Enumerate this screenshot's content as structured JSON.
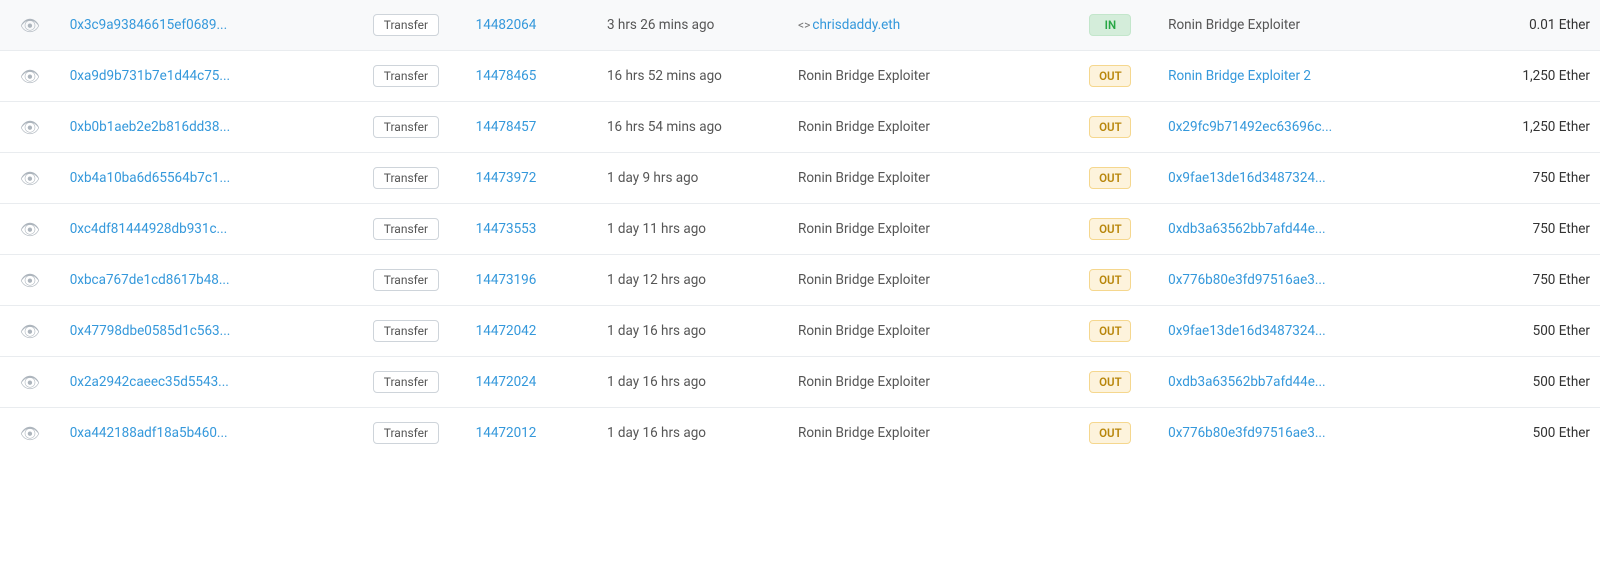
{
  "table": {
    "rows": [
      {
        "txHash": "0x3c9a93846615ef0689...",
        "type": "Transfer",
        "block": "14482064",
        "age": "3 hrs 26 mins ago",
        "from": "chrisdaddy.eth",
        "fromIsContract": true,
        "fromIsLink": true,
        "direction": "IN",
        "to": "Ronin Bridge Exploiter",
        "toIsLink": false,
        "value": "0.01 Ether"
      },
      {
        "txHash": "0xa9d9b731b7e1d44c75...",
        "type": "Transfer",
        "block": "14478465",
        "age": "16 hrs 52 mins ago",
        "from": "Ronin Bridge Exploiter",
        "fromIsContract": false,
        "fromIsLink": false,
        "direction": "OUT",
        "to": "Ronin Bridge Exploiter 2",
        "toIsLink": true,
        "value": "1,250 Ether"
      },
      {
        "txHash": "0xb0b1aeb2e2b816dd38...",
        "type": "Transfer",
        "block": "14478457",
        "age": "16 hrs 54 mins ago",
        "from": "Ronin Bridge Exploiter",
        "fromIsContract": false,
        "fromIsLink": false,
        "direction": "OUT",
        "to": "0x29fc9b71492ec63696c...",
        "toIsLink": true,
        "value": "1,250 Ether"
      },
      {
        "txHash": "0xb4a10ba6d65564b7c1...",
        "type": "Transfer",
        "block": "14473972",
        "age": "1 day 9 hrs ago",
        "from": "Ronin Bridge Exploiter",
        "fromIsContract": false,
        "fromIsLink": false,
        "direction": "OUT",
        "to": "0x9fae13de16d3487324...",
        "toIsLink": true,
        "value": "750 Ether"
      },
      {
        "txHash": "0xc4df81444928db931c...",
        "type": "Transfer",
        "block": "14473553",
        "age": "1 day 11 hrs ago",
        "from": "Ronin Bridge Exploiter",
        "fromIsContract": false,
        "fromIsLink": false,
        "direction": "OUT",
        "to": "0xdb3a63562bb7afd44e...",
        "toIsLink": true,
        "value": "750 Ether"
      },
      {
        "txHash": "0xbca767de1cd8617b48...",
        "type": "Transfer",
        "block": "14473196",
        "age": "1 day 12 hrs ago",
        "from": "Ronin Bridge Exploiter",
        "fromIsContract": false,
        "fromIsLink": false,
        "direction": "OUT",
        "to": "0x776b80e3fd97516ae3...",
        "toIsLink": true,
        "value": "750 Ether"
      },
      {
        "txHash": "0x47798dbe0585d1c563...",
        "type": "Transfer",
        "block": "14472042",
        "age": "1 day 16 hrs ago",
        "from": "Ronin Bridge Exploiter",
        "fromIsContract": false,
        "fromIsLink": false,
        "direction": "OUT",
        "to": "0x9fae13de16d3487324...",
        "toIsLink": true,
        "value": "500 Ether"
      },
      {
        "txHash": "0x2a2942caeec35d5543...",
        "type": "Transfer",
        "block": "14472024",
        "age": "1 day 16 hrs ago",
        "from": "Ronin Bridge Exploiter",
        "fromIsContract": false,
        "fromIsLink": false,
        "direction": "OUT",
        "to": "0xdb3a63562bb7afd44e...",
        "toIsLink": true,
        "value": "500 Ether"
      },
      {
        "txHash": "0xa442188adf18a5b460...",
        "type": "Transfer",
        "block": "14472012",
        "age": "1 day 16 hrs ago",
        "from": "Ronin Bridge Exploiter",
        "fromIsContract": false,
        "fromIsLink": false,
        "direction": "OUT",
        "to": "0x776b80e3fd97516ae3...",
        "toIsLink": true,
        "value": "500 Ether"
      }
    ]
  }
}
